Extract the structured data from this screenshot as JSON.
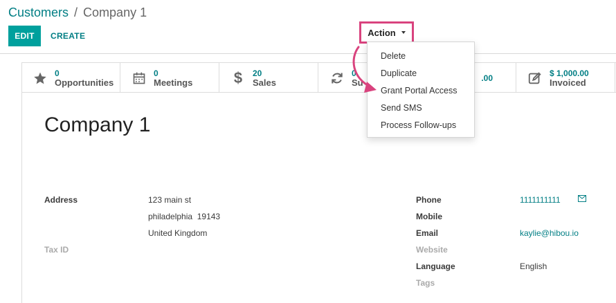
{
  "breadcrumb": {
    "parent": "Customers",
    "separator": "/",
    "current": "Company 1"
  },
  "toolbar": {
    "edit_label": "EDIT",
    "create_label": "CREATE",
    "action_label": "Action"
  },
  "action_menu": {
    "items": [
      "Delete",
      "Duplicate",
      "Grant Portal Access",
      "Send SMS",
      "Process Follow-ups"
    ]
  },
  "smart_buttons": [
    {
      "icon": "star-icon",
      "value": "0",
      "label": "Opportunities"
    },
    {
      "icon": "calendar-icon",
      "value": "0",
      "label": "Meetings"
    },
    {
      "icon": "dollar-icon",
      "value": "20",
      "label": "Sales"
    },
    {
      "icon": "refresh-icon",
      "value": "0",
      "label": "Su"
    },
    {
      "icon": "",
      "value": ".00",
      "label": ""
    },
    {
      "icon": "invoice-icon",
      "value": "$ 1,000.00",
      "label": "Invoiced"
    }
  ],
  "record": {
    "name": "Company 1"
  },
  "left_fields": {
    "address_label": "Address",
    "street": "123 main st",
    "city_zip": "philadelphia  19143",
    "country": "United Kingdom",
    "taxid_label": "Tax ID"
  },
  "right_fields": {
    "phone_label": "Phone",
    "phone_value": "1111111111",
    "mobile_label": "Mobile",
    "email_label": "Email",
    "email_value": "kaylie@hibou.io",
    "website_label": "Website",
    "language_label": "Language",
    "language_value": "English",
    "tags_label": "Tags"
  },
  "colors": {
    "primary": "#00a09d",
    "link": "#017e84",
    "highlight": "#d9437e"
  }
}
